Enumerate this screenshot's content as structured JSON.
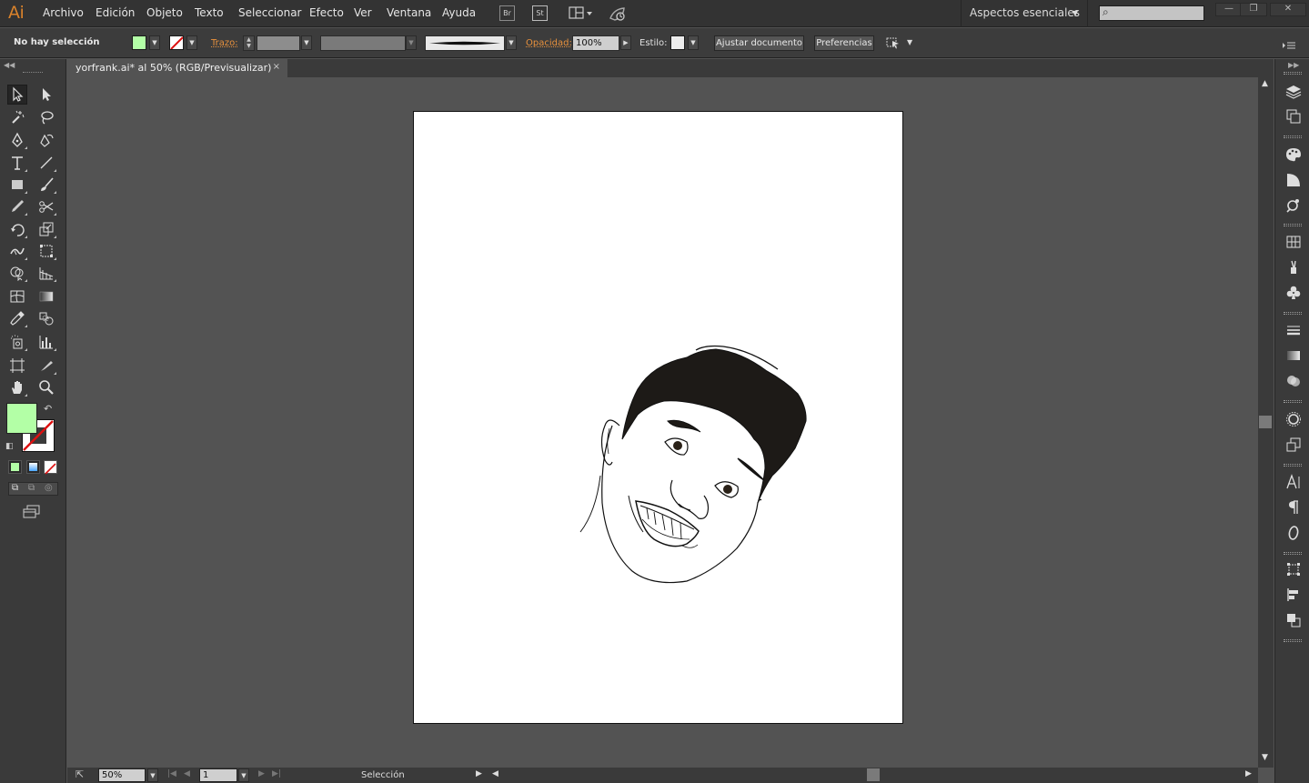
{
  "app": {
    "logo": "Ai"
  },
  "menu": {
    "items": [
      "Archivo",
      "Edición",
      "Objeto",
      "Texto",
      "Seleccionar",
      "Efecto",
      "Ver",
      "Ventana",
      "Ayuda"
    ],
    "bridge_label": "Br",
    "stock_label": "St",
    "workspace": "Aspectos esenciales"
  },
  "controlbar": {
    "selection_status": "No hay selección",
    "fill_color": "#b3ffa6",
    "stroke_label": "Trazo:",
    "opacity_label": "Opacidad:",
    "opacity_value": "100%",
    "style_label": "Estilo:",
    "adjust_document_button": "Ajustar documento",
    "preferences_button": "Preferencias"
  },
  "document": {
    "tab_title": "yorfrank.ai* al 50% (RGB/Previsualizar)",
    "close_glyph": "×"
  },
  "toolbox": {
    "fill_color": "#b3ffa6"
  },
  "statusbar": {
    "zoom": "50%",
    "artboard_number": "1",
    "current_tool": "Selección"
  }
}
